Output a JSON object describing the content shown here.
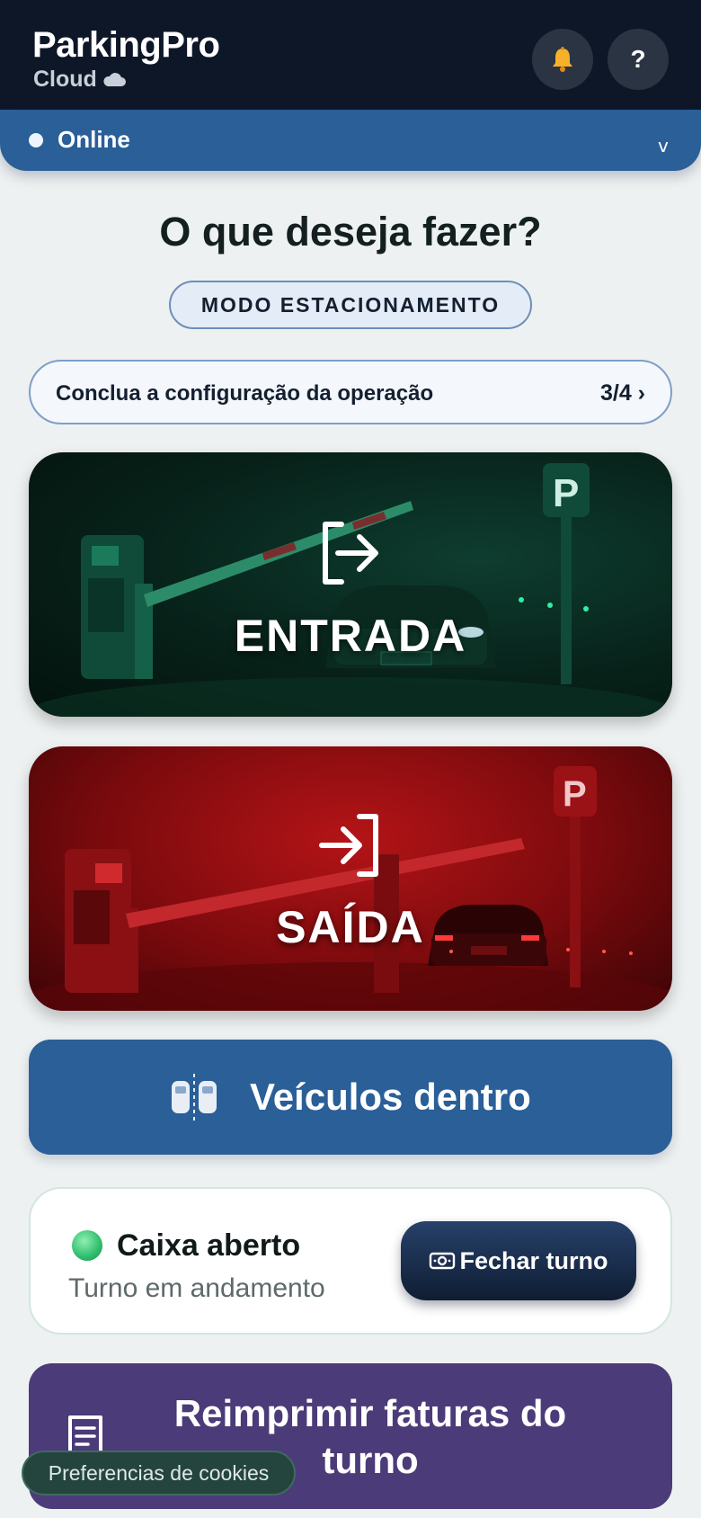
{
  "header": {
    "app_name": "ParkingPro",
    "app_sub": "Cloud",
    "help_label": "?"
  },
  "status": {
    "label": "Online",
    "chevron": "v"
  },
  "main": {
    "headline": "O que deseja fazer?",
    "mode": "MODO ESTACIONAMENTO",
    "config": {
      "text": "Conclua a configuração da operação",
      "step": "3/4 ›"
    },
    "actions": [
      {
        "label": "ENTRADA",
        "icon": "login-arrow-icon",
        "color": "#0e3d2f"
      },
      {
        "label": "SAÍDA",
        "icon": "logout-arrow-icon",
        "color": "#b41417"
      }
    ],
    "vehicles": {
      "label": "Veículos dentro",
      "icon": "parked-cars-icon",
      "color": "#2a5f98"
    },
    "cash": {
      "title": "Caixa aberto",
      "subtitle": "Turno em andamento",
      "close_button": "Fechar turno",
      "status_color": "#2ebd6d"
    },
    "reprint": {
      "label": "Reimprimir faturas do turno",
      "icon": "receipt-icon",
      "color": "#4b3b78"
    }
  },
  "cookie": {
    "label": "Preferencias de cookies"
  }
}
